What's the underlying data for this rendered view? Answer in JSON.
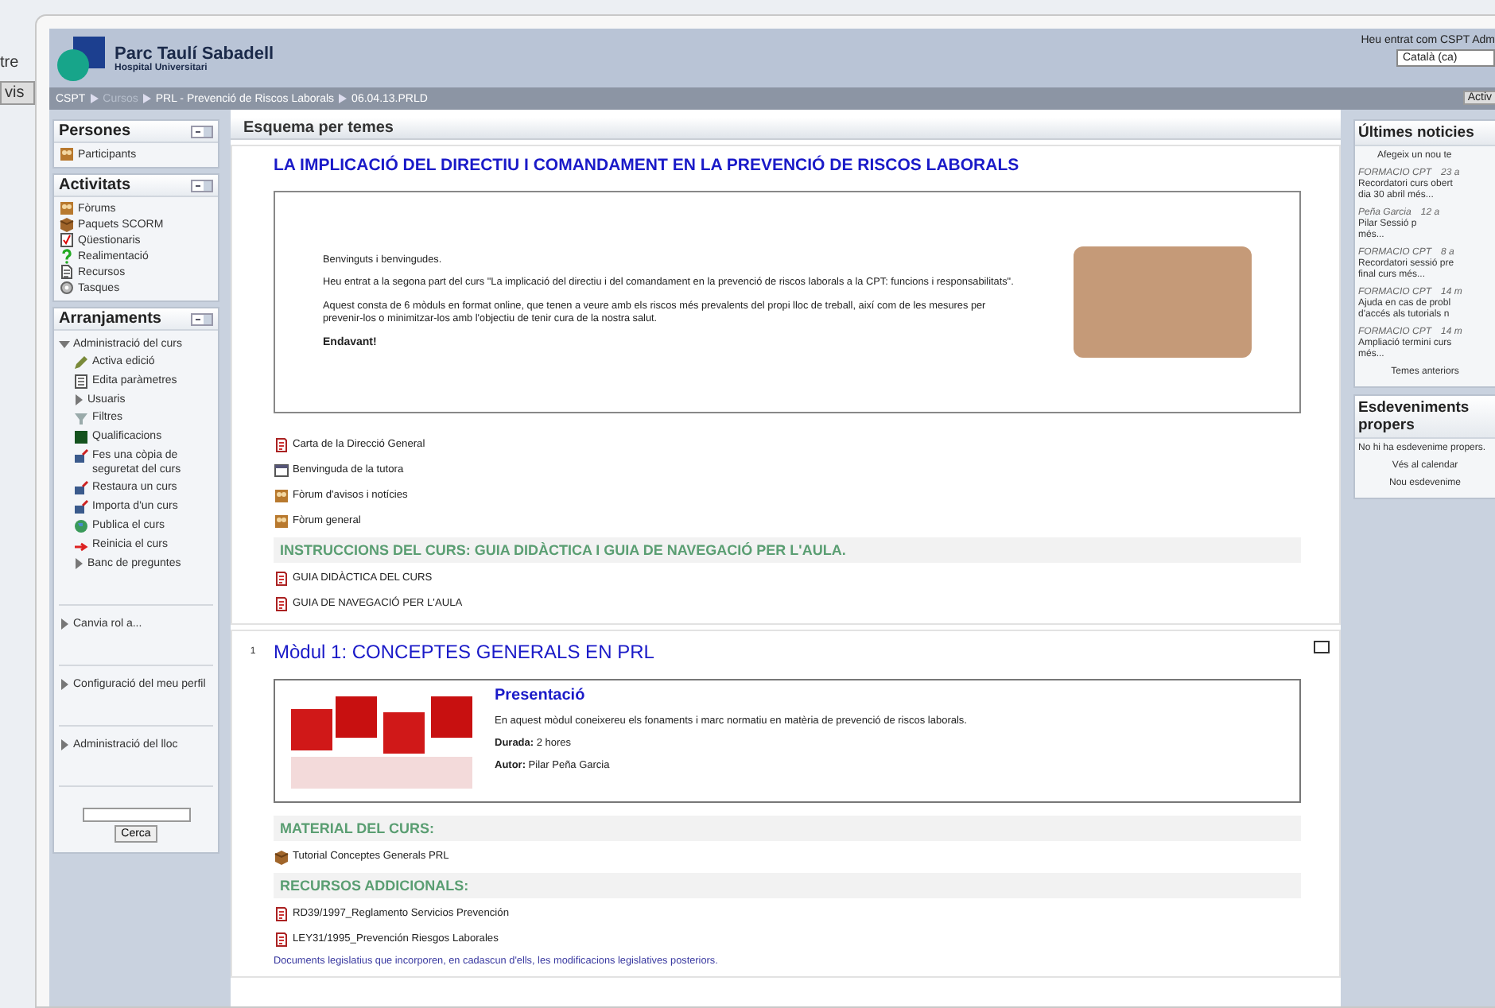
{
  "background_window": {
    "label": "tre",
    "button": "vis"
  },
  "header": {
    "logo_title": "Parc Taulí Sabadell",
    "logo_subtitle": "Hospital Universitari",
    "login_info": "Heu entrat com CSPT Adm",
    "language": "Català (ca)",
    "edit_button": "Activ"
  },
  "breadcrumb": [
    {
      "label": "CSPT",
      "dimmed": false
    },
    {
      "label": "Cursos",
      "dimmed": true
    },
    {
      "label": "PRL - Prevenció de Riscos Laborals",
      "dimmed": false
    },
    {
      "label": "06.04.13.PRLD",
      "dimmed": false
    }
  ],
  "left_blocks": [
    {
      "title": "Persones",
      "items": [
        {
          "label": "Participants",
          "kind": "people"
        }
      ]
    },
    {
      "title": "Activitats",
      "items": [
        {
          "label": "Fòrums",
          "kind": "forum"
        },
        {
          "label": "Paquets SCORM",
          "kind": "package"
        },
        {
          "label": "Qüestionaris",
          "kind": "quiz"
        },
        {
          "label": "Realimentació",
          "kind": "question"
        },
        {
          "label": "Recursos",
          "kind": "document"
        },
        {
          "label": "Tasques",
          "kind": "task"
        }
      ]
    },
    {
      "title": "Arranjaments",
      "tree": [
        {
          "label": "Administració del curs",
          "expanded": true,
          "children": [
            {
              "label": "Activa edició",
              "kind": "edit"
            },
            {
              "label": "Edita paràmetres",
              "kind": "form"
            },
            {
              "label": "Usuaris",
              "expanded": false
            },
            {
              "label": "Filtres",
              "kind": "funnel"
            },
            {
              "label": "Qualificacions",
              "kind": "grades"
            },
            {
              "label": "Fes una còpia de seguretat del curs",
              "kind": "backup"
            },
            {
              "label": "Restaura un curs",
              "kind": "backup"
            },
            {
              "label": "Importa d'un curs",
              "kind": "backup"
            },
            {
              "label": "Publica el curs",
              "kind": "globe"
            },
            {
              "label": "Reinicia el curs",
              "kind": "reset"
            },
            {
              "label": "Banc de preguntes",
              "expanded": false
            }
          ]
        },
        {
          "label": "Canvia rol a...",
          "expanded": false
        },
        {
          "label": "Configuració del meu perfil",
          "expanded": false
        },
        {
          "label": "Administració del lloc",
          "expanded": false
        }
      ],
      "search_button": "Cerca"
    }
  ],
  "section_header": "Esquema per temes",
  "sections": [
    {
      "title": "LA IMPLICACIÓ DEL DIRECTIU I COMANDAMENT EN LA PREVENCIÓ DE RISCOS LABORALS",
      "intro": [
        {
          "text": "Benvinguts i benvingudes.",
          "kind": "plain"
        },
        {
          "text": "Heu entrat a la segona part del curs \"La implicació del directiu i del comandament en la prevenció de riscos laborals a la CPT: funcions i responsabilitats\".",
          "kind": "plain"
        },
        {
          "text": "Aquest consta de 6 mòduls en format online, que tenen a veure amb els riscos més prevalents del propi lloc de treball, així com de les mesures per prevenir-los o minimitzar-los amb l'objectiu de tenir cura de la nostra salut.",
          "kind": "plain"
        },
        {
          "text": "Endavant!",
          "kind": "bold"
        }
      ],
      "blocks": [
        {
          "kind": "pdf",
          "label": "Carta de la Direcció General"
        },
        {
          "kind": "web",
          "label": "Benvinguda de la tutora"
        },
        {
          "kind": "forum",
          "label": "Fòrum d'avisos i notícies"
        },
        {
          "kind": "forum",
          "label": "Fòrum general"
        },
        {
          "kind": "subheading",
          "label": "INSTRUCCIONS DEL CURS: GUIA DIDÀCTICA I GUIA DE NAVEGACIÓ PER L'AULA."
        },
        {
          "kind": "pdf",
          "label": "GUIA DIDÀCTICA DEL CURS"
        },
        {
          "kind": "pdf",
          "label": "GUIA DE NAVEGACIÓ PER L'AULA"
        }
      ]
    },
    {
      "number": "1",
      "title": "Mòdul 1: CONCEPTES GENERALS EN PRL",
      "summary": {
        "heading": "Presentació",
        "lines": [
          "En aquest mòdul coneixereu els fonaments i marc normatiu en matèria de prevenció de riscos laborals.",
          "**Durada:** 2 hores",
          "**Autor:** Pilar Peña Garcia"
        ]
      },
      "blocks": [
        {
          "kind": "subheading",
          "label": "MATERIAL DEL CURS:"
        },
        {
          "kind": "package",
          "label": "Tutorial Conceptes Generals PRL"
        },
        {
          "kind": "subheading",
          "label": "RECURSOS ADDICIONALS:"
        },
        {
          "kind": "pdf",
          "label": "RD39/1997_Reglamento Servicios Prevención"
        },
        {
          "kind": "pdf",
          "label": "LEY31/1995_Prevención Riesgos Laborales"
        },
        {
          "kind": "note",
          "label": "Documents legislatius que incorporen, en cadascun d'ells, les modificacions legislatives posteriors."
        }
      ]
    }
  ],
  "right_blocks": [
    {
      "title": "Últimes noticies",
      "add_link": "Afegeix un nou te",
      "posts": [
        {
          "author": "FORMACIO CPT",
          "date": "23 a",
          "lines": [
            "Recordatori curs obert",
            "dia 30 abril més..."
          ]
        },
        {
          "author": "Peña Garcia",
          "date": "12 a",
          "lines": [
            "Pilar     Sessió p",
            "més..."
          ]
        },
        {
          "author": "FORMACIO CPT",
          "date": "8 a",
          "lines": [
            "Recordatori sessió pre",
            "final curs més..."
          ]
        },
        {
          "author": "FORMACIO CPT",
          "date": "14 m",
          "lines": [
            "Ajuda en cas de probl",
            "d'accés als tutorials n"
          ]
        },
        {
          "author": "FORMACIO CPT",
          "date": "14 m",
          "lines": [
            "Ampliació termini curs",
            "més..."
          ]
        }
      ],
      "footer": "Temes anteriors"
    },
    {
      "title": "Esdeveniments propers",
      "text": "No hi ha esdevenime propers.",
      "links": [
        "Vés al calendar",
        "Nou esdevenime"
      ]
    }
  ]
}
